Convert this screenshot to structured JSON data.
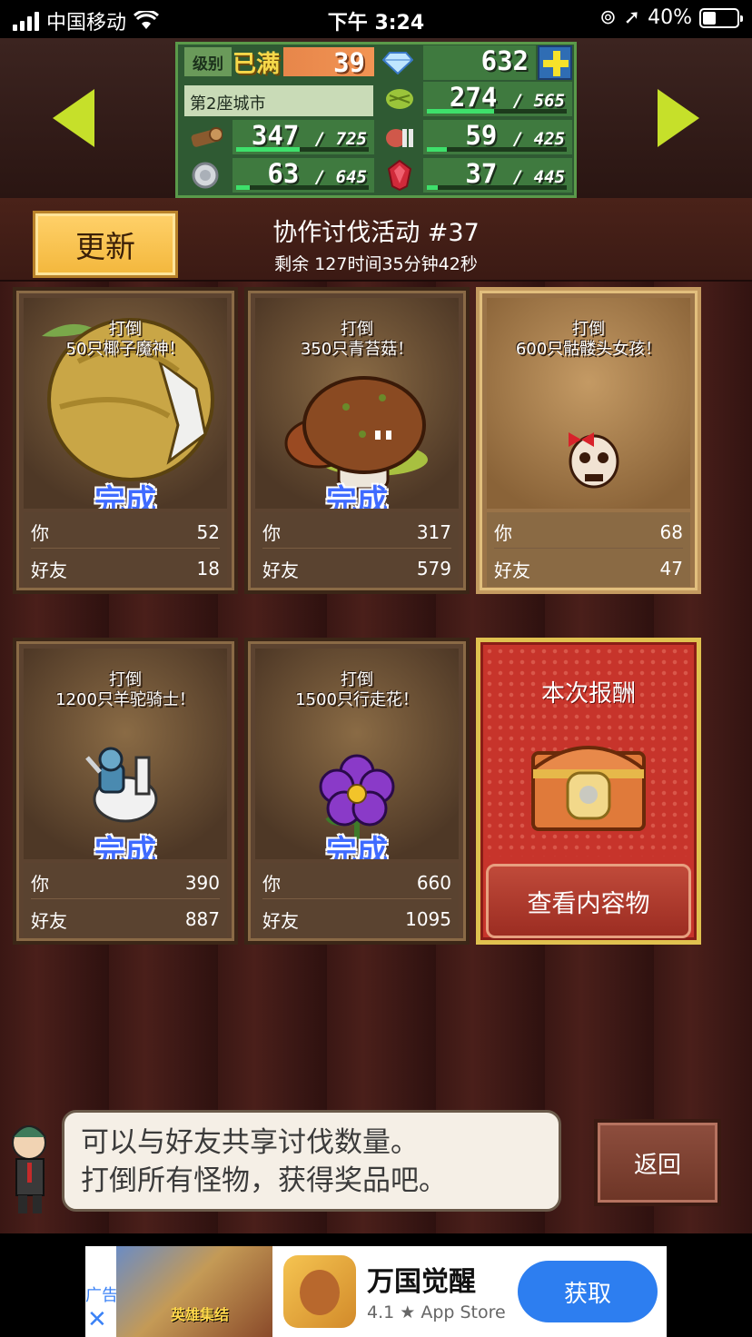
{
  "status_bar": {
    "carrier": "中国移动",
    "time": "下午 3:24",
    "battery": "40%"
  },
  "resources": {
    "level_label": "级别",
    "level_max": "已满",
    "level": "39",
    "gems": "632",
    "city": "第2座城市",
    "wood": {
      "value": "347",
      "max": "725",
      "fraction": 0.48
    },
    "grass": {
      "value": "274",
      "max": "565",
      "fraction": 0.48
    },
    "meat": {
      "value": "59",
      "max": "425",
      "fraction": 0.14
    },
    "silver": {
      "value": "63",
      "max": "645",
      "fraction": 0.1
    },
    "ruby": {
      "value": "37",
      "max": "445",
      "fraction": 0.08
    }
  },
  "header": {
    "update_label": "更新",
    "event_title": "协作讨伐活动 #37",
    "remaining": "剩余 127时间35分钟42秒"
  },
  "cards": [
    {
      "goal1": "打倒",
      "goal2": "50只椰子魔神！",
      "done": "完成",
      "you_label": "你",
      "you": "52",
      "friend_label": "好友",
      "friend": "18"
    },
    {
      "goal1": "打倒",
      "goal2": "350只青苔菇！",
      "done": "完成",
      "you_label": "你",
      "you": "317",
      "friend_label": "好友",
      "friend": "579"
    },
    {
      "goal1": "打倒",
      "goal2": "600只骷髅头女孩！",
      "done": "",
      "you_label": "你",
      "you": "68",
      "friend_label": "好友",
      "friend": "47"
    },
    {
      "goal1": "打倒",
      "goal2": "1200只羊驼骑士！",
      "done": "完成",
      "you_label": "你",
      "you": "390",
      "friend_label": "好友",
      "friend": "887"
    },
    {
      "goal1": "打倒",
      "goal2": "1500只行走花！",
      "done": "完成",
      "you_label": "你",
      "you": "660",
      "friend_label": "好友",
      "friend": "1095"
    }
  ],
  "reward": {
    "title": "本次报酬",
    "view_label": "查看内容物"
  },
  "dialog": {
    "line1": "可以与好友共享讨伐数量。",
    "line2": "打倒所有怪物，获得奖品吧。"
  },
  "back_label": "返回",
  "ad": {
    "tag": "广告",
    "close": "✕",
    "image_text": "英雄集结",
    "app_name": "万国觉醒",
    "rating": "4.1 ★ App Store",
    "get_label": "获取"
  }
}
